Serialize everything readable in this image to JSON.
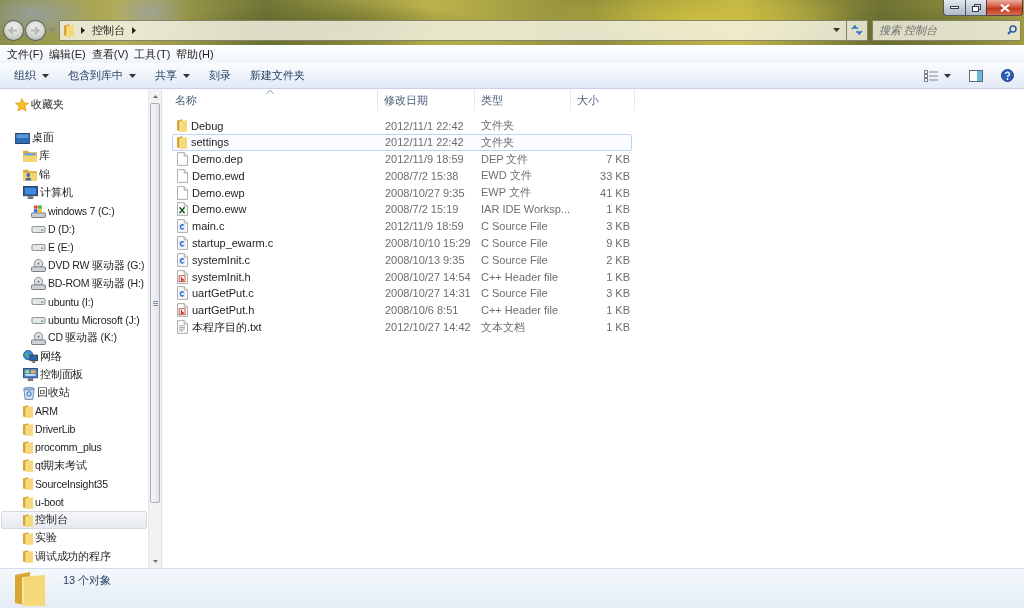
{
  "address_bar": {
    "path": [
      "控制台"
    ]
  },
  "search": {
    "placeholder": "搜索 控制台"
  },
  "menu": [
    "文件(F)",
    "编辑(E)",
    "查看(V)",
    "工具(T)",
    "帮助(H)"
  ],
  "toolbar": [
    {
      "label": "组织",
      "has_menu": true
    },
    {
      "label": "包含到库中",
      "has_menu": true
    },
    {
      "label": "共享",
      "has_menu": true
    },
    {
      "label": "刻录",
      "has_menu": false
    },
    {
      "label": "新建文件夹",
      "has_menu": false
    }
  ],
  "sidebar": {
    "items": [
      {
        "label": "收藏夹",
        "kind": "favorites",
        "selected": false
      },
      {
        "label": "桌面",
        "kind": "desktop",
        "selected": false,
        "children": [
          {
            "label": "库",
            "kind": "library",
            "selected": false
          },
          {
            "label": "锦",
            "kind": "user",
            "selected": false
          },
          {
            "label": "计算机",
            "kind": "computer",
            "selected": false,
            "children": [
              {
                "label": "windows 7 (C:)",
                "kind": "system-drive",
                "selected": false
              },
              {
                "label": "D (D:)",
                "kind": "drive",
                "selected": false
              },
              {
                "label": "E (E:)",
                "kind": "drive",
                "selected": false
              },
              {
                "label": "DVD RW 驱动器 (G:)",
                "kind": "optical-drive",
                "selected": false
              },
              {
                "label": "BD-ROM 驱动器 (H:)",
                "kind": "optical-drive",
                "selected": false
              },
              {
                "label": "ubuntu (I:)",
                "kind": "drive",
                "selected": false
              },
              {
                "label": "ubuntu Microsoft (J:)",
                "kind": "drive",
                "selected": false
              },
              {
                "label": "CD 驱动器 (K:)",
                "kind": "optical-drive",
                "selected": false
              }
            ]
          },
          {
            "label": "网络",
            "kind": "network",
            "selected": false
          },
          {
            "label": "控制面板",
            "kind": "control-panel",
            "selected": false
          },
          {
            "label": "回收站",
            "kind": "recycle-bin",
            "selected": false
          },
          {
            "label": "ARM",
            "kind": "folder",
            "selected": false
          },
          {
            "label": "DriverLib",
            "kind": "folder",
            "selected": false
          },
          {
            "label": "procomm_plus",
            "kind": "folder",
            "selected": false
          },
          {
            "label": "qt期末考试",
            "kind": "folder",
            "selected": false
          },
          {
            "label": "SourceInsight35",
            "kind": "folder",
            "selected": false
          },
          {
            "label": "u-boot",
            "kind": "folder",
            "selected": false
          },
          {
            "label": "控制台",
            "kind": "folder",
            "selected": true
          },
          {
            "label": "实验",
            "kind": "folder",
            "selected": false
          },
          {
            "label": "调试成功的程序",
            "kind": "folder",
            "selected": false
          }
        ]
      }
    ]
  },
  "files": {
    "columns": [
      {
        "label": "名称",
        "sorted": true
      },
      {
        "label": "修改日期",
        "sorted": false
      },
      {
        "label": "类型",
        "sorted": false
      },
      {
        "label": "大小",
        "sorted": false
      }
    ],
    "rows": [
      {
        "name": "Debug",
        "date": "2012/11/1 22:42",
        "type": "文件夹",
        "kind": "folder",
        "focused": false
      },
      {
        "name": "settings",
        "date": "2012/11/1 22:42",
        "type": "文件夹",
        "kind": "folder",
        "focused": true
      },
      {
        "name": "Demo.dep",
        "date": "2012/11/9 18:59",
        "type": "DEP 文件",
        "size": "7 KB",
        "kind": "file",
        "focused": false
      },
      {
        "name": "Demo.ewd",
        "date": "2008/7/2 15:38",
        "type": "EWD 文件",
        "size": "33 KB",
        "kind": "file",
        "focused": false
      },
      {
        "name": "Demo.ewp",
        "date": "2008/10/27 9:35",
        "type": "EWP 文件",
        "size": "41 KB",
        "kind": "file",
        "focused": false
      },
      {
        "name": "Demo.eww",
        "date": "2008/7/2 15:19",
        "type": "IAR IDE Worksp...",
        "size": "1 KB",
        "kind": "workspace",
        "focused": false
      },
      {
        "name": "main.c",
        "date": "2012/11/9 18:59",
        "type": "C Source File",
        "size": "3 KB",
        "kind": "c-source",
        "focused": false
      },
      {
        "name": "startup_ewarm.c",
        "date": "2008/10/10 15:29",
        "type": "C Source File",
        "size": "9 KB",
        "kind": "c-source",
        "focused": false
      },
      {
        "name": "systemInit.c",
        "date": "2008/10/13 9:35",
        "type": "C Source File",
        "size": "2 KB",
        "kind": "c-source",
        "focused": false
      },
      {
        "name": "systemInit.h",
        "date": "2008/10/27 14:54",
        "type": "C++ Header file",
        "size": "1 KB",
        "kind": "header",
        "focused": false
      },
      {
        "name": "uartGetPut.c",
        "date": "2008/10/27 14:31",
        "type": "C Source File",
        "size": "3 KB",
        "kind": "c-source",
        "focused": false
      },
      {
        "name": "uartGetPut.h",
        "date": "2008/10/6 8:51",
        "type": "C++ Header file",
        "size": "1 KB",
        "kind": "header",
        "focused": false
      },
      {
        "name": "本程序目的.txt",
        "date": "2012/10/27 14:42",
        "type": "文本文档",
        "size": "1 KB",
        "kind": "text",
        "focused": false
      }
    ]
  },
  "status_bar": {
    "text": "13 个对象"
  }
}
